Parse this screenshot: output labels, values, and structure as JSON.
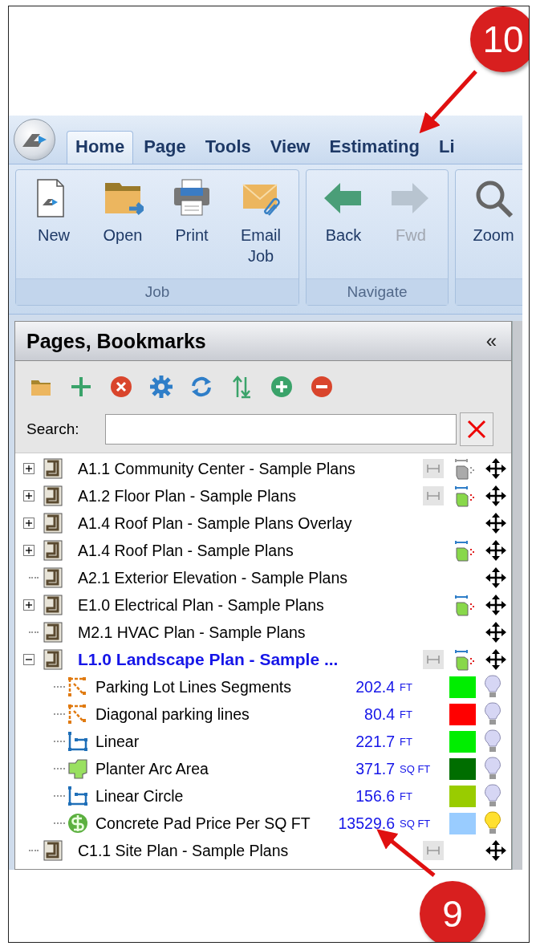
{
  "callouts": [
    {
      "number": "10"
    },
    {
      "number": "9"
    }
  ],
  "tabs": [
    {
      "label": "Home",
      "selected": true
    },
    {
      "label": "Page",
      "selected": false
    },
    {
      "label": "Tools",
      "selected": false
    },
    {
      "label": "View",
      "selected": false
    },
    {
      "label": "Estimating",
      "selected": false
    },
    {
      "label": "Li",
      "selected": false
    }
  ],
  "ribbon_groups": [
    {
      "label": "Job",
      "buttons": [
        {
          "label": "New",
          "disabled": false
        },
        {
          "label": "Open",
          "disabled": false
        },
        {
          "label": "Print",
          "disabled": false
        },
        {
          "label": "Email Job",
          "disabled": false
        }
      ]
    },
    {
      "label": "Navigate",
      "buttons": [
        {
          "label": "Back",
          "disabled": false
        },
        {
          "label": "Fwd",
          "disabled": true
        }
      ]
    },
    {
      "buttons": [
        {
          "label": "Zoom",
          "disabled": false
        }
      ]
    }
  ],
  "panel": {
    "title": "Pages, Bookmarks",
    "collapse": "«",
    "toolbar": [
      {
        "kind": "folder"
      },
      {
        "kind": "add"
      },
      {
        "kind": "delete"
      },
      {
        "kind": "settings"
      },
      {
        "kind": "refresh"
      },
      {
        "kind": "sort"
      },
      {
        "kind": "expand"
      },
      {
        "kind": "collapse"
      }
    ],
    "search": {
      "label": "Search:"
    },
    "pages": [
      {
        "name": "A1.1 Community Center - Sample Plans",
        "expandable": true,
        "expanded": false,
        "selected": false,
        "scale": true,
        "takeoffs": true,
        "takeoffs_active": false
      },
      {
        "name": "A1.2 Floor Plan - Sample Plans",
        "expandable": true,
        "expanded": false,
        "selected": false,
        "scale": true,
        "takeoffs": true,
        "takeoffs_active": true
      },
      {
        "name": "A1.4 Roof Plan - Sample Plans Overlay",
        "expandable": true,
        "expanded": false,
        "selected": false,
        "scale": false,
        "takeoffs": false
      },
      {
        "name": "A1.4 Roof Plan - Sample Plans",
        "expandable": true,
        "expanded": false,
        "selected": false,
        "scale": false,
        "takeoffs": true,
        "takeoffs_active": true
      },
      {
        "name": "A2.1 Exterior Elevation - Sample Plans",
        "expandable": false,
        "selected": false,
        "scale": false,
        "takeoffs": false
      },
      {
        "name": "E1.0 Electrical Plan - Sample Plans",
        "expandable": true,
        "expanded": false,
        "selected": false,
        "scale": false,
        "takeoffs": true,
        "takeoffs_active": true
      },
      {
        "name": "M2.1 HVAC Plan - Sample Plans",
        "expandable": false,
        "selected": false,
        "scale": false,
        "takeoffs": false
      },
      {
        "name": "L1.0 Landscape Plan - Sample ...",
        "expandable": true,
        "expanded": true,
        "selected": true,
        "scale": true,
        "takeoffs": true,
        "takeoffs_active": true,
        "children": [
          {
            "kind": "segment",
            "name": "Parking Lot Lines Segments",
            "value": "202.4",
            "unit": "FT",
            "color": "#00ee00",
            "visible": false
          },
          {
            "kind": "segment",
            "name": "Diagonal parking lines",
            "value": "80.4",
            "unit": "FT",
            "color": "#ff0000",
            "visible": false
          },
          {
            "kind": "linear",
            "name": "Linear",
            "value": "221.7",
            "unit": "FT",
            "color": "#00ee00",
            "visible": false
          },
          {
            "kind": "area",
            "name": "Planter Arc Area",
            "value": "371.7",
            "unit": "SQ FT",
            "color": "#006e00",
            "visible": false
          },
          {
            "kind": "linear",
            "name": "Linear Circle",
            "value": "156.6",
            "unit": "FT",
            "color": "#99cc00",
            "visible": false
          },
          {
            "kind": "price",
            "name": "Concrete Pad Price Per SQ FT",
            "value": "13529.6",
            "unit": "SQ FT",
            "color": "#99ccff",
            "visible": true
          }
        ]
      },
      {
        "name": "C1.1 Site Plan - Sample Plans",
        "expandable": false,
        "selected": false,
        "scale": true,
        "takeoffs": false
      }
    ]
  }
}
